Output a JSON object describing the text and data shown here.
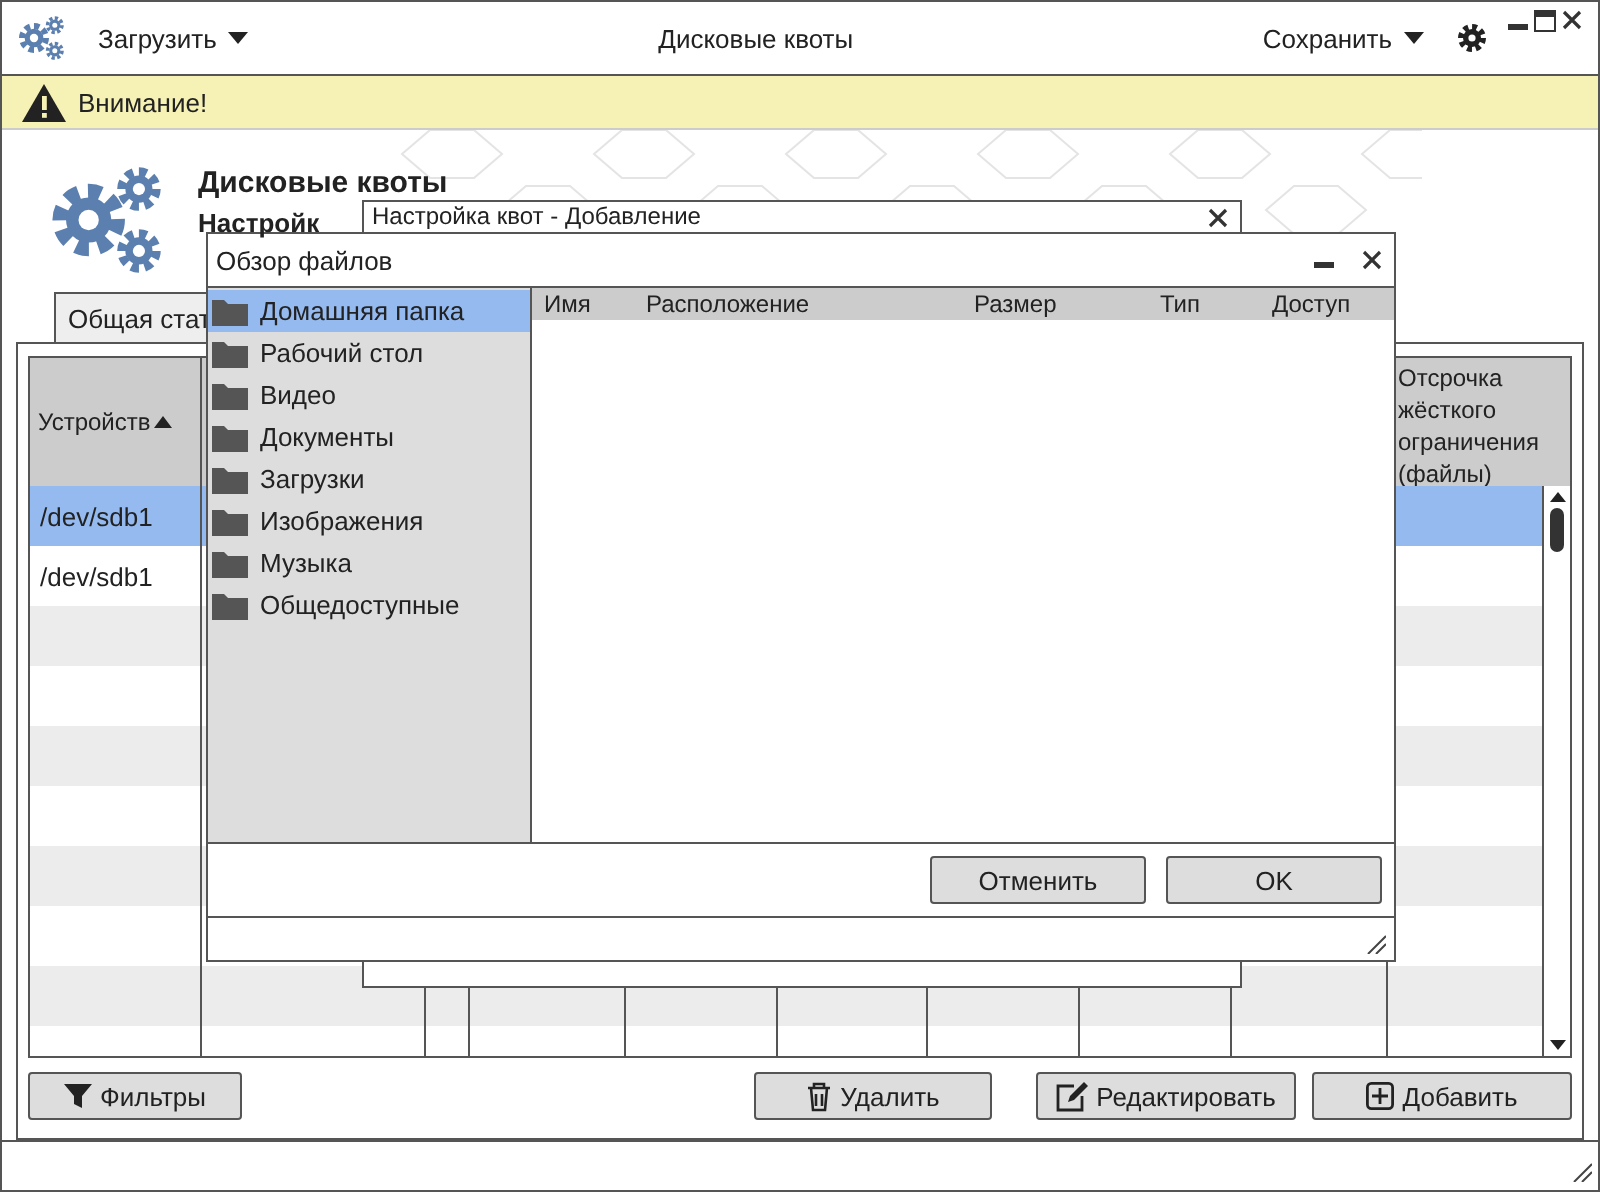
{
  "app": {
    "title": "Дисковые квоты",
    "load_menu": "Загрузить",
    "save_menu": "Сохранить"
  },
  "warning": "Внимание!",
  "header": {
    "title": "Дисковые квоты",
    "subtitle": "Настройк"
  },
  "tabs": [
    {
      "label": "Общая стат",
      "selected": true
    }
  ],
  "table": {
    "columns": [
      {
        "label": "Устройств",
        "sort_ascending": true
      },
      {
        "label": "Отсрочка жёсткого ограничения (файлы)"
      }
    ],
    "rows": [
      {
        "device": "/dev/sdb1",
        "selected": true
      },
      {
        "device": "/dev/sdb1",
        "selected": false
      },
      {
        "selected": false
      },
      {
        "selected": false
      },
      {
        "selected": false
      },
      {
        "selected": false
      },
      {
        "selected": false
      },
      {
        "selected": false
      },
      {
        "selected": false
      },
      {
        "selected": false
      }
    ]
  },
  "buttons": [
    {
      "label": "Фильтры",
      "kind": "filter"
    },
    {
      "label": "Удалить",
      "kind": "trash"
    },
    {
      "label": "Редактировать",
      "kind": "edit"
    },
    {
      "label": "Добавить",
      "kind": "plus"
    }
  ],
  "quota_dialog": {
    "title": "Настройка квот - Добавление"
  },
  "file_dialog": {
    "title": "Обзор файлов",
    "folders": [
      {
        "label": "Домашняя папка",
        "selected": true
      },
      {
        "label": "Рабочий стол",
        "selected": false
      },
      {
        "label": "Видео",
        "selected": false
      },
      {
        "label": "Документы",
        "selected": false
      },
      {
        "label": "Загрузки",
        "selected": false
      },
      {
        "label": "Изображения",
        "selected": false
      },
      {
        "label": "Музыка",
        "selected": false
      },
      {
        "label": "Общедоступные",
        "selected": false
      }
    ],
    "columns": [
      "Имя",
      "Расположение",
      "Размер",
      "Тип",
      "Доступ"
    ],
    "buttons": [
      "Отменить",
      "OK"
    ]
  }
}
